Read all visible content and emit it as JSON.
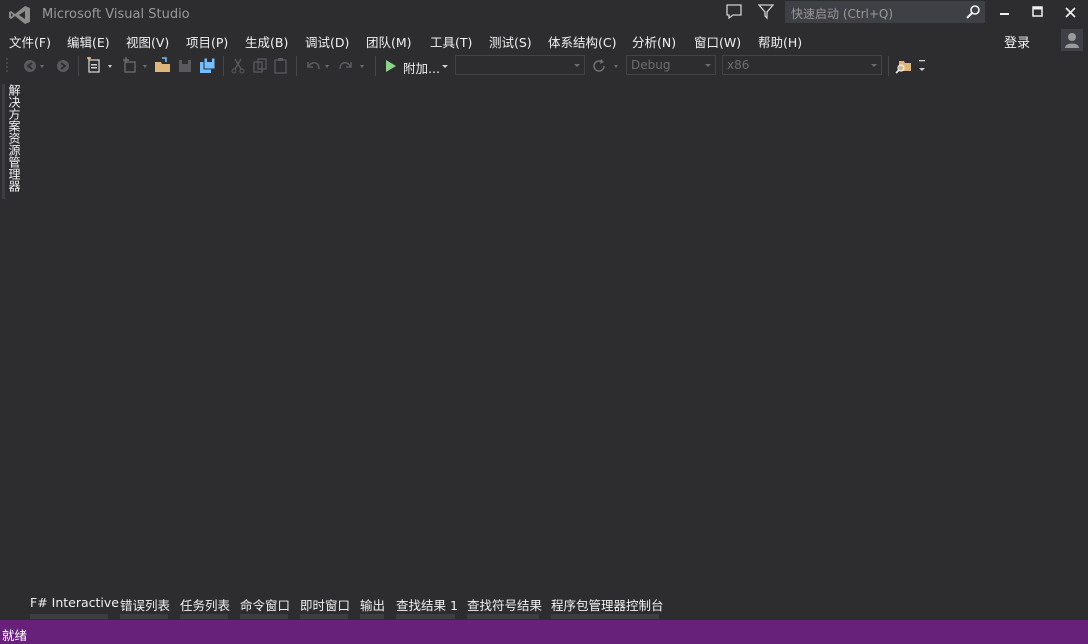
{
  "window": {
    "title": "Microsoft Visual Studio"
  },
  "quick_launch": {
    "placeholder": "快速启动 (Ctrl+Q)"
  },
  "menu": [
    "文件(F)",
    "编辑(E)",
    "视图(V)",
    "项目(P)",
    "生成(B)",
    "调试(D)",
    "团队(M)",
    "工具(T)",
    "测试(S)",
    "体系结构(C)",
    "分析(N)",
    "窗口(W)",
    "帮助(H)"
  ],
  "account": {
    "signin_label": "登录"
  },
  "toolbar": {
    "start_label": "附加...",
    "config_value": "Debug",
    "platform_value": "x86"
  },
  "side_tab": {
    "label": "解决方案资源管理器"
  },
  "bottom_tabs": [
    "F# Interactive",
    "错误列表",
    "任务列表",
    "命令窗口",
    "即时窗口",
    "输出",
    "查找结果 1",
    "查找符号结果",
    "程序包管理器控制台"
  ],
  "status": {
    "text": "就绪"
  },
  "colors": {
    "background": "#2d2d30",
    "status_bar": "#68217a",
    "accent_icon": "#75beff"
  }
}
